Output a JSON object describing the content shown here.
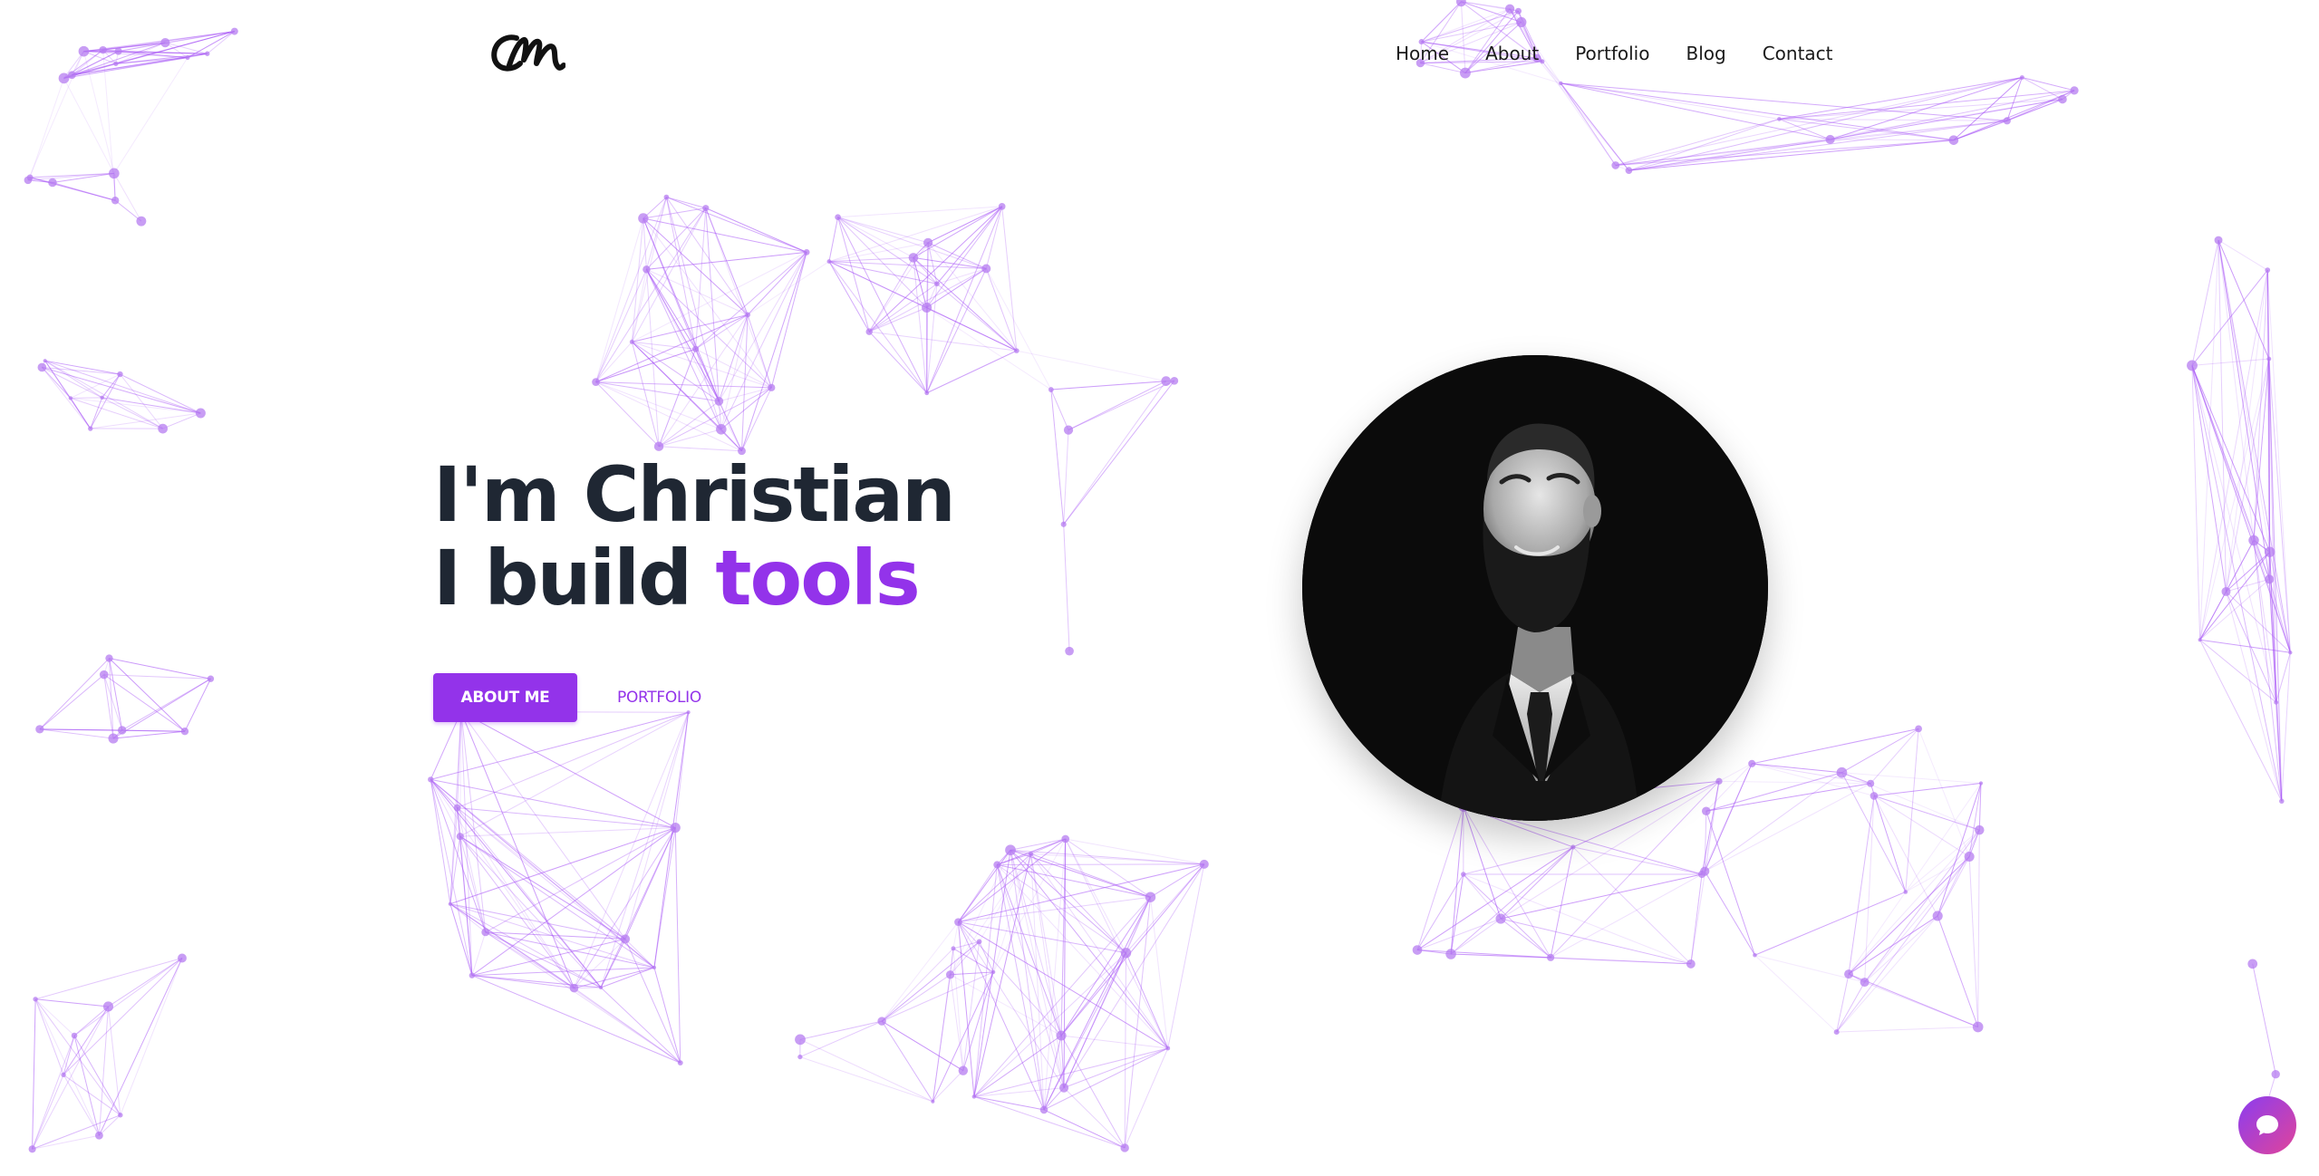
{
  "logo": {
    "text": "CM",
    "icon": "cm-script-logo"
  },
  "nav": {
    "items": [
      {
        "label": "Home"
      },
      {
        "label": "About"
      },
      {
        "label": "Portfolio"
      },
      {
        "label": "Blog"
      },
      {
        "label": "Contact"
      }
    ]
  },
  "hero": {
    "line1": "I'm Christian",
    "line2_prefix": "I build ",
    "line2_accent": "tools"
  },
  "cta": {
    "primary_label": "ABOUT ME",
    "secondary_label": "PORTFOLIO"
  },
  "portrait": {
    "icon": "profile-photo"
  },
  "chat": {
    "icon": "chat-bubble-icon"
  },
  "colors": {
    "accent": "#9333ea",
    "heading": "#1f2733",
    "network_line": "#a855f7",
    "network_node": "#b57cf0",
    "chat_gradient_start": "#8b3df0",
    "chat_gradient_end": "#e0449a"
  }
}
